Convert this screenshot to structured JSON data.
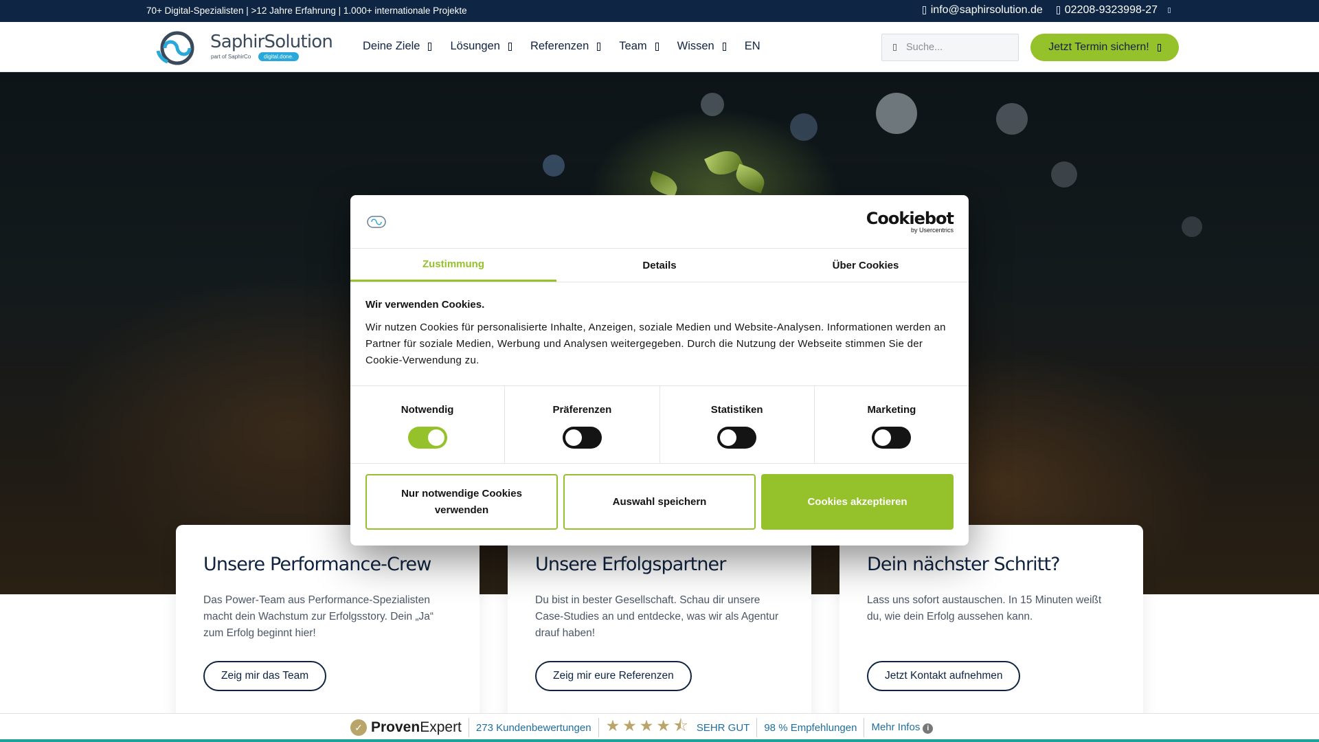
{
  "topbar": {
    "claim": "70+ Digital-Spezialisten | >12 Jahre Erfahrung | 1.000+ internationale Projekte",
    "email": "info@saphirsolution.de",
    "phone": "02208-9323998-27"
  },
  "header": {
    "logo": {
      "name": "SaphirSolution",
      "part": "part of SaphirCo",
      "pill": "digital.done."
    },
    "nav": [
      {
        "label": "Deine Ziele",
        "has_caret": true
      },
      {
        "label": "Lösungen",
        "has_caret": true
      },
      {
        "label": "Referenzen",
        "has_caret": true
      },
      {
        "label": "Team",
        "has_caret": true
      },
      {
        "label": "Wissen",
        "has_caret": true
      },
      {
        "label": "EN",
        "has_caret": false
      }
    ],
    "search": {
      "placeholder": "Suche...",
      "value": ""
    },
    "cta_label": "Jetzt Termin sichern!"
  },
  "cookie": {
    "brand_name": "Cookiebot",
    "brand_sub": "by Usercentrics",
    "tabs": [
      {
        "label": "Zustimmung",
        "active": true
      },
      {
        "label": "Details",
        "active": false
      },
      {
        "label": "Über Cookies",
        "active": false
      }
    ],
    "heading": "Wir verwenden Cookies.",
    "text": "Wir nutzen Cookies für personalisierte Inhalte, Anzeigen, soziale Medien und Website-Analysen. Informationen werden an Partner für soziale Medien, Werbung und Analysen weitergegeben. Durch die Nutzung der Webseite stimmen Sie der Cookie-Verwendung zu.",
    "categories": [
      {
        "label": "Notwendig",
        "enabled": true
      },
      {
        "label": "Präferenzen",
        "enabled": false
      },
      {
        "label": "Statistiken",
        "enabled": false
      },
      {
        "label": "Marketing",
        "enabled": false
      }
    ],
    "buttons": {
      "necessary": "Nur notwendige Cookies verwenden",
      "save": "Auswahl speichern",
      "accept": "Cookies akzeptieren"
    }
  },
  "cards": [
    {
      "title": "Unsere Performance-Crew",
      "text": "Das Power-Team aus Performance-Spezialisten macht dein Wachstum zur Erfolgsstory. Dein „Ja“ zum Erfolg beginnt hier!",
      "button": "Zeig mir das Team"
    },
    {
      "title": "Unsere Erfolgspartner",
      "text": "Du bist in bester Gesellschaft. Schau dir unsere Case-Studies an und entdecke, was wir als Agentur drauf haben!",
      "button": "Zeig mir eure Referenzen"
    },
    {
      "title": "Dein nächster Schritt?",
      "text": "Lass uns sofort austauschen. In 15 Minuten weißt du, wie dein Erfolg aussehen kann.",
      "button": "Jetzt Kontakt aufnehmen"
    }
  ],
  "proven_expert": {
    "brand_bold": "Proven",
    "brand_light": "Expert",
    "reviews": "273 Kundenbewertungen",
    "rating_stars": 4.5,
    "rating_label": "SEHR GUT",
    "recommendations": "98 % Empfehlungen",
    "more": "Mehr Infos"
  },
  "colors": {
    "navy": "#0e2644",
    "accent_green": "#95c12b",
    "logo_blue": "#28a8db",
    "star_gold": "#b9a46a",
    "teal_line": "#1aa39a"
  }
}
